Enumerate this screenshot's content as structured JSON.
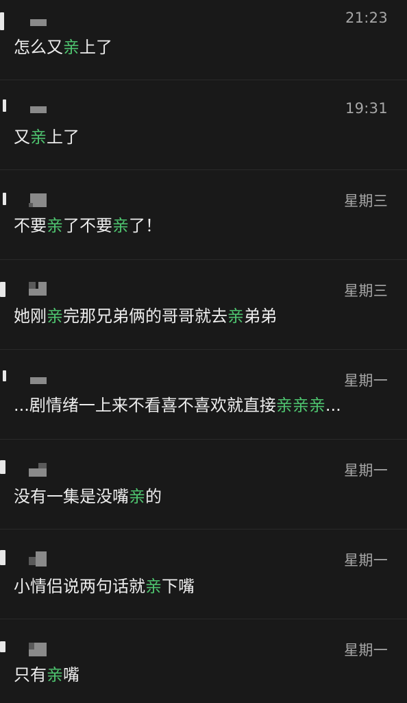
{
  "colors": {
    "background": "#191919",
    "text": "#ededed",
    "time": "#a7a7a7",
    "highlight": "#4ec46f",
    "divider": "#2a2a2a"
  },
  "results": [
    {
      "time": "21:23",
      "message": [
        {
          "text": "怎么又",
          "hl": false
        },
        {
          "text": "亲",
          "hl": true
        },
        {
          "text": "上了",
          "hl": false
        }
      ]
    },
    {
      "time": "19:31",
      "message": [
        {
          "text": "又",
          "hl": false
        },
        {
          "text": "亲",
          "hl": true
        },
        {
          "text": "上了",
          "hl": false
        }
      ]
    },
    {
      "time": "星期三",
      "message": [
        {
          "text": "不要",
          "hl": false
        },
        {
          "text": "亲",
          "hl": true
        },
        {
          "text": "了不要",
          "hl": false
        },
        {
          "text": "亲",
          "hl": true
        },
        {
          "text": "了！",
          "hl": false
        }
      ]
    },
    {
      "time": "星期三",
      "message": [
        {
          "text": "她刚",
          "hl": false
        },
        {
          "text": "亲",
          "hl": true
        },
        {
          "text": "完那兄弟俩的哥哥就去",
          "hl": false
        },
        {
          "text": "亲",
          "hl": true
        },
        {
          "text": "弟弟",
          "hl": false
        }
      ]
    },
    {
      "time": "星期一",
      "message": [
        {
          "text": "...剧情绪一上来不看喜不喜欢就直接",
          "hl": false
        },
        {
          "text": "亲亲亲",
          "hl": true
        },
        {
          "text": "...",
          "hl": false
        }
      ]
    },
    {
      "time": "星期一",
      "message": [
        {
          "text": "没有一集是没嘴",
          "hl": false
        },
        {
          "text": "亲",
          "hl": true
        },
        {
          "text": "的",
          "hl": false
        }
      ]
    },
    {
      "time": "星期一",
      "message": [
        {
          "text": "小情侣说两句话就",
          "hl": false
        },
        {
          "text": "亲",
          "hl": true
        },
        {
          "text": "下嘴",
          "hl": false
        }
      ]
    },
    {
      "time": "星期一",
      "message": [
        {
          "text": "只有",
          "hl": false
        },
        {
          "text": "亲",
          "hl": true
        },
        {
          "text": "嘴",
          "hl": false
        }
      ]
    }
  ]
}
